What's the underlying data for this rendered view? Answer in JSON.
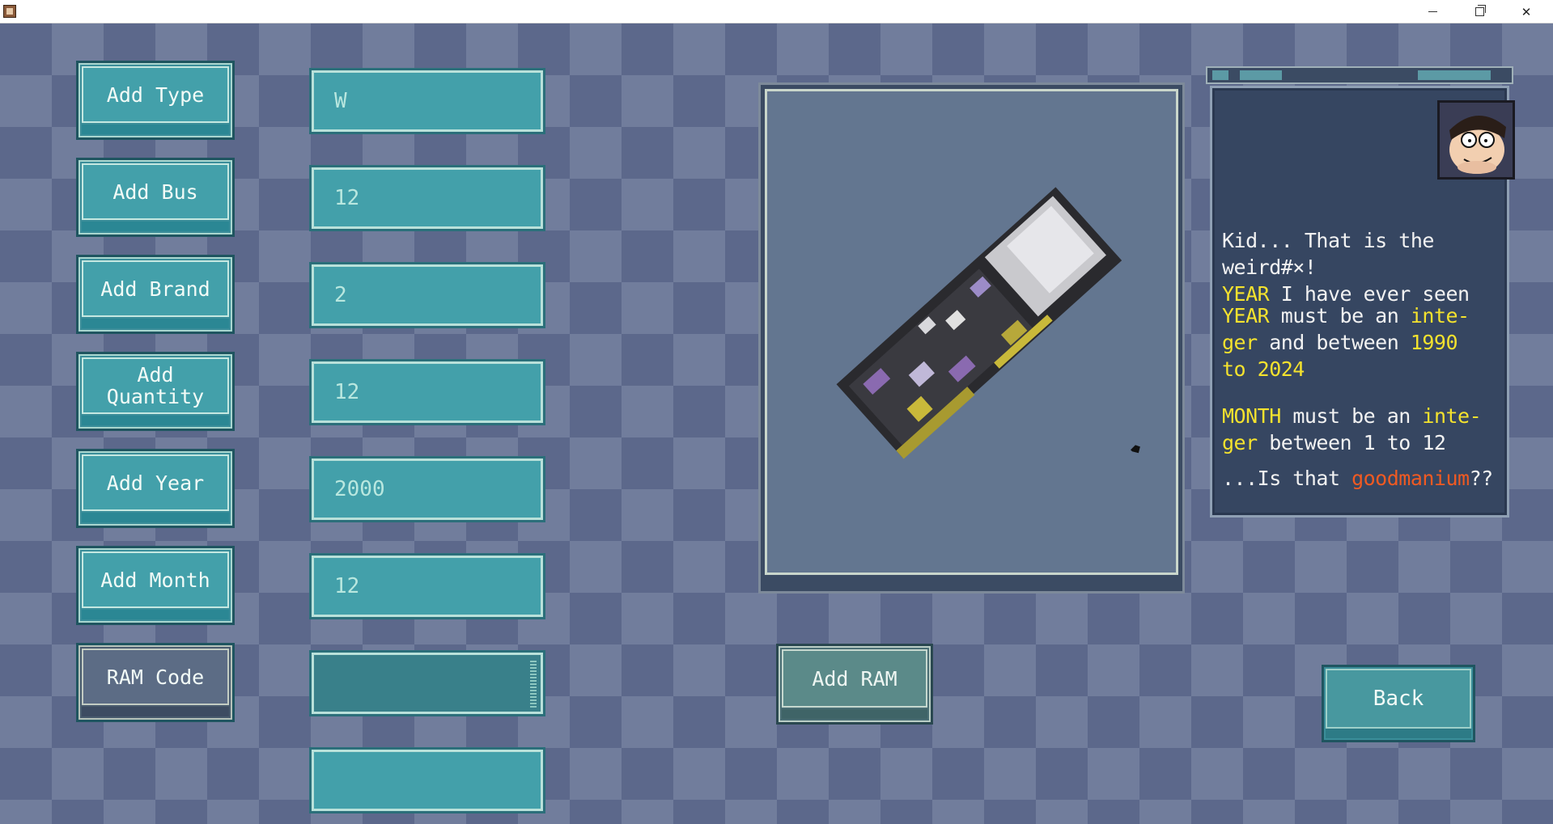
{
  "titlebar": {
    "minimize": "—",
    "maximize": "❐",
    "close": "✕"
  },
  "buttons": {
    "add_type": "Add Type",
    "add_bus": "Add Bus",
    "add_brand": "Add Brand",
    "add_quantity": "Add Quantity",
    "add_year": "Add Year",
    "add_month": "Add Month",
    "ram_code": "RAM Code",
    "add_ram": "Add RAM",
    "back": "Back"
  },
  "fields": {
    "type": "W",
    "bus": "12",
    "brand": "2",
    "quantity": "12",
    "year": "2000",
    "month": "12",
    "ram_code": "",
    "extra": ""
  },
  "dialog": {
    "line1a": "Kid... That is the weird#×!",
    "line1b_hl": "YEAR",
    "line1b": " I have ever seen",
    "year_kw": "YEAR",
    "year_mid": " must be an ",
    "integer_1": "inte-",
    "integer_2": "ger",
    "year_and": " and between ",
    "year_min": "1990",
    "year_to": "to 2024",
    "month_kw": "MONTH",
    "month_mid": " must be an ",
    "integer_3": "inte-",
    "integer_4": "ger",
    "month_rest": " between 1 to 12",
    "last_a": "...Is that ",
    "last_hl": "goodmanium",
    "last_b": "??"
  },
  "colors": {
    "button_teal": "#43a0aa",
    "highlight_yellow": "#f4e22e",
    "highlight_orange": "#f05a22",
    "panel_dark": "#364661"
  }
}
